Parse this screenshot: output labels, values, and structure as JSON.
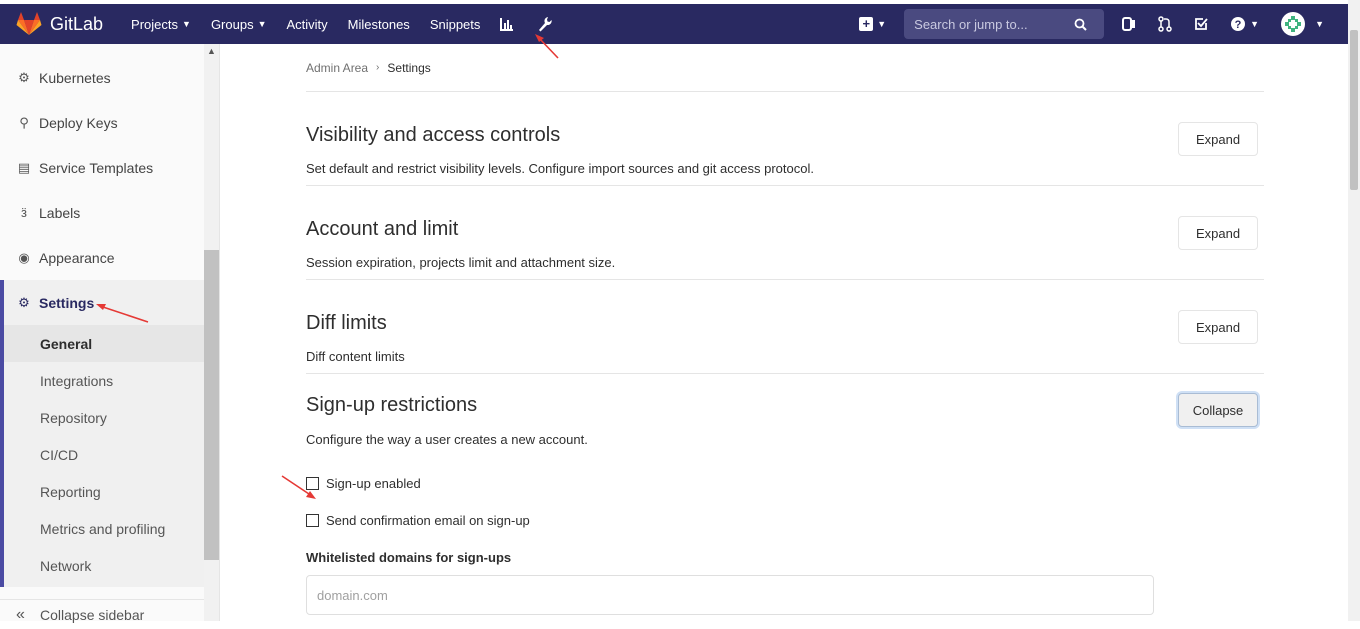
{
  "header": {
    "logo_text": "GitLab",
    "nav": [
      {
        "label": "Projects",
        "caret": true
      },
      {
        "label": "Groups",
        "caret": true
      },
      {
        "label": "Activity",
        "caret": false
      },
      {
        "label": "Milestones",
        "caret": false
      },
      {
        "label": "Snippets",
        "caret": false
      }
    ],
    "search_placeholder": "Search or jump to...",
    "bar_color": "#292961"
  },
  "sidebar": {
    "items": [
      {
        "label": "Kubernetes",
        "icon": "kubernetes-icon"
      },
      {
        "label": "Deploy Keys",
        "icon": "key-icon"
      },
      {
        "label": "Service Templates",
        "icon": "template-icon"
      },
      {
        "label": "Labels",
        "icon": "labels-icon"
      },
      {
        "label": "Appearance",
        "icon": "palette-icon"
      },
      {
        "label": "Settings",
        "icon": "gear-icon"
      }
    ],
    "sub_items": [
      "General",
      "Integrations",
      "Repository",
      "CI/CD",
      "Reporting",
      "Metrics and profiling",
      "Network"
    ],
    "collapse_label": "Collapse sidebar"
  },
  "breadcrumb": {
    "parent": "Admin Area",
    "current": "Settings"
  },
  "sections": [
    {
      "title": "Visibility and access controls",
      "description": "Set default and restrict visibility levels. Configure import sources and git access protocol.",
      "button": "Expand"
    },
    {
      "title": "Account and limit",
      "description": "Session expiration, projects limit and attachment size.",
      "button": "Expand"
    },
    {
      "title": "Diff limits",
      "description": "Diff content limits",
      "button": "Expand"
    }
  ],
  "signup": {
    "title": "Sign-up restrictions",
    "description": "Configure the way a user creates a new account.",
    "button": "Collapse",
    "checkbox_signup": "Sign-up enabled",
    "checkbox_confirmation": "Send confirmation email on sign-up",
    "whitelist_label": "Whitelisted domains for sign-ups",
    "whitelist_placeholder": "domain.com"
  }
}
